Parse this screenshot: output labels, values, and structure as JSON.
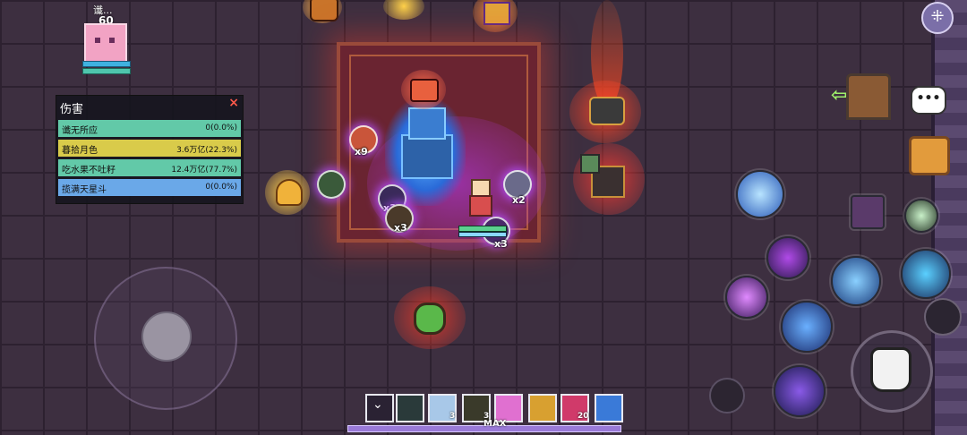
{
  "player": {
    "name": "谶...",
    "level": "60"
  },
  "damage_panel": {
    "title": "伤害",
    "close": "×",
    "rows": [
      {
        "name": "谶无所应",
        "value": "0(0.0%)"
      },
      {
        "name": "暮拾月色",
        "value": "3.6万亿(22.3%)"
      },
      {
        "name": "吃水果不吐籽",
        "value": "12.4万亿(77.7%)"
      },
      {
        "name": "揽满天星斗",
        "value": "0(0.0%)"
      }
    ]
  },
  "drops": [
    {
      "count": "x9"
    },
    {
      "count": "x3"
    },
    {
      "count": "x3"
    },
    {
      "count": "x2"
    },
    {
      "count": "x3"
    }
  ],
  "hud": {
    "menu_icon": "menu-icon",
    "chat_label": "•••",
    "hotbar": [
      {
        "icon": "chevron-down-icon",
        "count": ""
      },
      {
        "icon": "shadow-pet-icon",
        "count": ""
      },
      {
        "icon": "flag-card-icon",
        "count": "3"
      },
      {
        "icon": "bag-item-icon",
        "count": "3"
      },
      {
        "icon": "pink-slime-icon",
        "count": ""
      },
      {
        "icon": "crown-icon",
        "count": ""
      },
      {
        "icon": "heart-icon",
        "count": "20"
      },
      {
        "icon": "blue-flower-icon",
        "count": ""
      }
    ],
    "xp_label": "MAX"
  },
  "colors": {
    "panel_green": "#62c9a8",
    "panel_yellow": "#d9cb4a",
    "panel_blue": "#6aa8e8",
    "close_red": "#ff5a4a"
  }
}
